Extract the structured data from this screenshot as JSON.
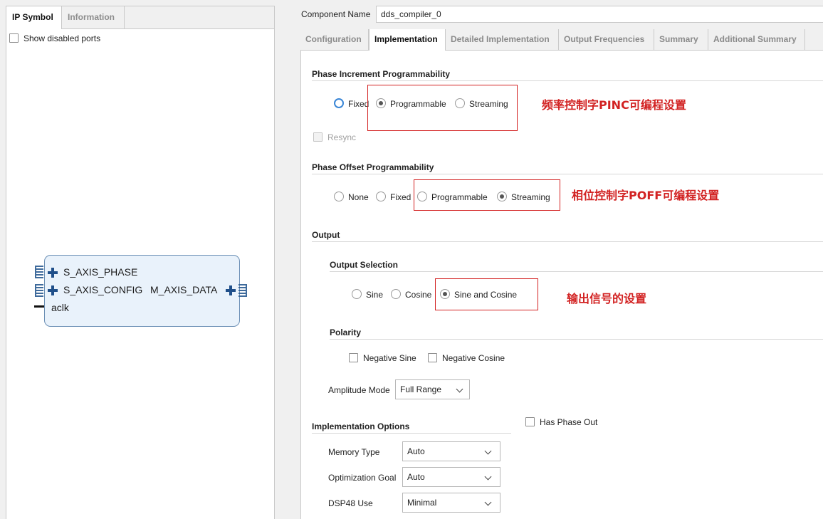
{
  "left": {
    "tabs": [
      {
        "label": "IP Symbol",
        "active": true
      },
      {
        "label": "Information",
        "active": false
      }
    ],
    "show_disabled_ports": {
      "label": "Show disabled ports",
      "checked": false
    },
    "block": {
      "ports_left": [
        "S_AXIS_PHASE",
        "S_AXIS_CONFIG",
        "aclk"
      ],
      "ports_right": [
        "M_AXIS_DATA"
      ]
    }
  },
  "right": {
    "component_name": {
      "label": "Component Name",
      "value": "dds_compiler_0"
    },
    "tabs": [
      {
        "label": "Configuration",
        "active": false
      },
      {
        "label": "Implementation",
        "active": true
      },
      {
        "label": "Detailed Implementation",
        "active": false
      },
      {
        "label": "Output Frequencies",
        "active": false
      },
      {
        "label": "Summary",
        "active": false
      },
      {
        "label": "Additional Summary",
        "active": false
      }
    ],
    "phase_increment": {
      "title": "Phase Increment Programmability",
      "options": [
        "Fixed",
        "Programmable",
        "Streaming"
      ],
      "selected": "Programmable",
      "resync": {
        "label": "Resync",
        "checked": false,
        "disabled": true
      },
      "annotation": "频率控制字PINC可编程设置"
    },
    "phase_offset": {
      "title": "Phase Offset Programmability",
      "options": [
        "None",
        "Fixed",
        "Programmable",
        "Streaming"
      ],
      "selected": "Streaming",
      "annotation": "相位控制字POFF可编程设置"
    },
    "output": {
      "title": "Output",
      "selection": {
        "title": "Output Selection",
        "options": [
          "Sine",
          "Cosine",
          "Sine and Cosine"
        ],
        "selected": "Sine and Cosine",
        "annotation": "输出信号的设置"
      },
      "polarity": {
        "title": "Polarity",
        "negative_sine": {
          "label": "Negative Sine",
          "checked": false
        },
        "negative_cosine": {
          "label": "Negative Cosine",
          "checked": false
        }
      },
      "amplitude_mode": {
        "label": "Amplitude Mode",
        "value": "Full Range"
      }
    },
    "implementation_options": {
      "title": "Implementation Options",
      "has_phase_out": {
        "label": "Has Phase Out",
        "checked": false
      },
      "memory_type": {
        "label": "Memory Type",
        "value": "Auto"
      },
      "optimization_goal": {
        "label": "Optimization Goal",
        "value": "Auto"
      },
      "dsp48_use": {
        "label": "DSP48 Use",
        "value": "Minimal"
      }
    }
  },
  "colors": {
    "annotation_red": "#d32121",
    "block_fill": "#e9f2fb",
    "block_border": "#6b8fb5",
    "focus_blue": "#3a86d6"
  }
}
